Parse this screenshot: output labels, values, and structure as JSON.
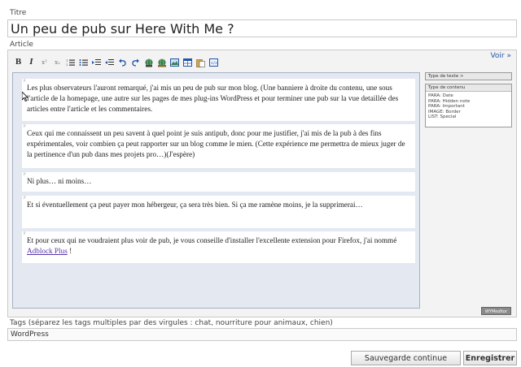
{
  "title_label": "Titre",
  "title_value": "Un peu de pub sur Here With Me ?",
  "article_label": "Article",
  "voir_link": "Voir »",
  "toolbar": {
    "bold": "B",
    "italic": "I",
    "superscript": "x²",
    "subscript": "x₂"
  },
  "paragraphs": [
    {
      "marker": "p",
      "text": "Les plus observateurs l'auront remarqué, j'ai mis un peu de pub sur mon blog. (Une banniere à droite du contenu, une sous l'article de la homepage, une autre sur les pages de mes plug-ins WordPress et pour terminer une pub sur la vue detaillée des articles entre l'article et les commentaires."
    },
    {
      "marker": "p",
      "text": "Ceux qui me connaissent un peu savent à quel point je suis antipub, donc pour me justifier, j'ai mis de la pub à des fins expérimentales, voir combien ça peut rapporter sur un blog comme le mien. (Cette expérience me permettra de mieux juger de la pertinence d'un pub dans mes projets pro…)(J'espère)"
    },
    {
      "marker": "p",
      "text": "Ni plus… ni moins…"
    },
    {
      "marker": "p",
      "text": "Et si éventuellement ça peut payer mon hébergeur, ça sera très bien. Si ça me ramène moins, je la supprimerai…"
    },
    {
      "marker": "p",
      "text_before": "Et pour ceux qui ne voudraient plus voir de pub, je vous conseille d'installer l'excellente extension pour Firefox, j'ai nommé ",
      "link": "Adblock Plus",
      "text_after": " !"
    }
  ],
  "sidebar": {
    "text_type_header": "Type de texte >",
    "content_type_header": "Type de contenu",
    "content_types": [
      "PARA: Date",
      "PARA: Hidden note",
      "PARA: Important",
      "IMAGE: Border",
      "LIST: Special"
    ]
  },
  "wymeditor_badge": "WYMeditor",
  "tags_label": "Tags (séparez les tags multiples par des virgules : chat, nourriture pour animaux, chien)",
  "tags_value": "WordPress",
  "buttons": {
    "save_continue": "Sauvegarde continue",
    "save": "Enregistrer"
  }
}
